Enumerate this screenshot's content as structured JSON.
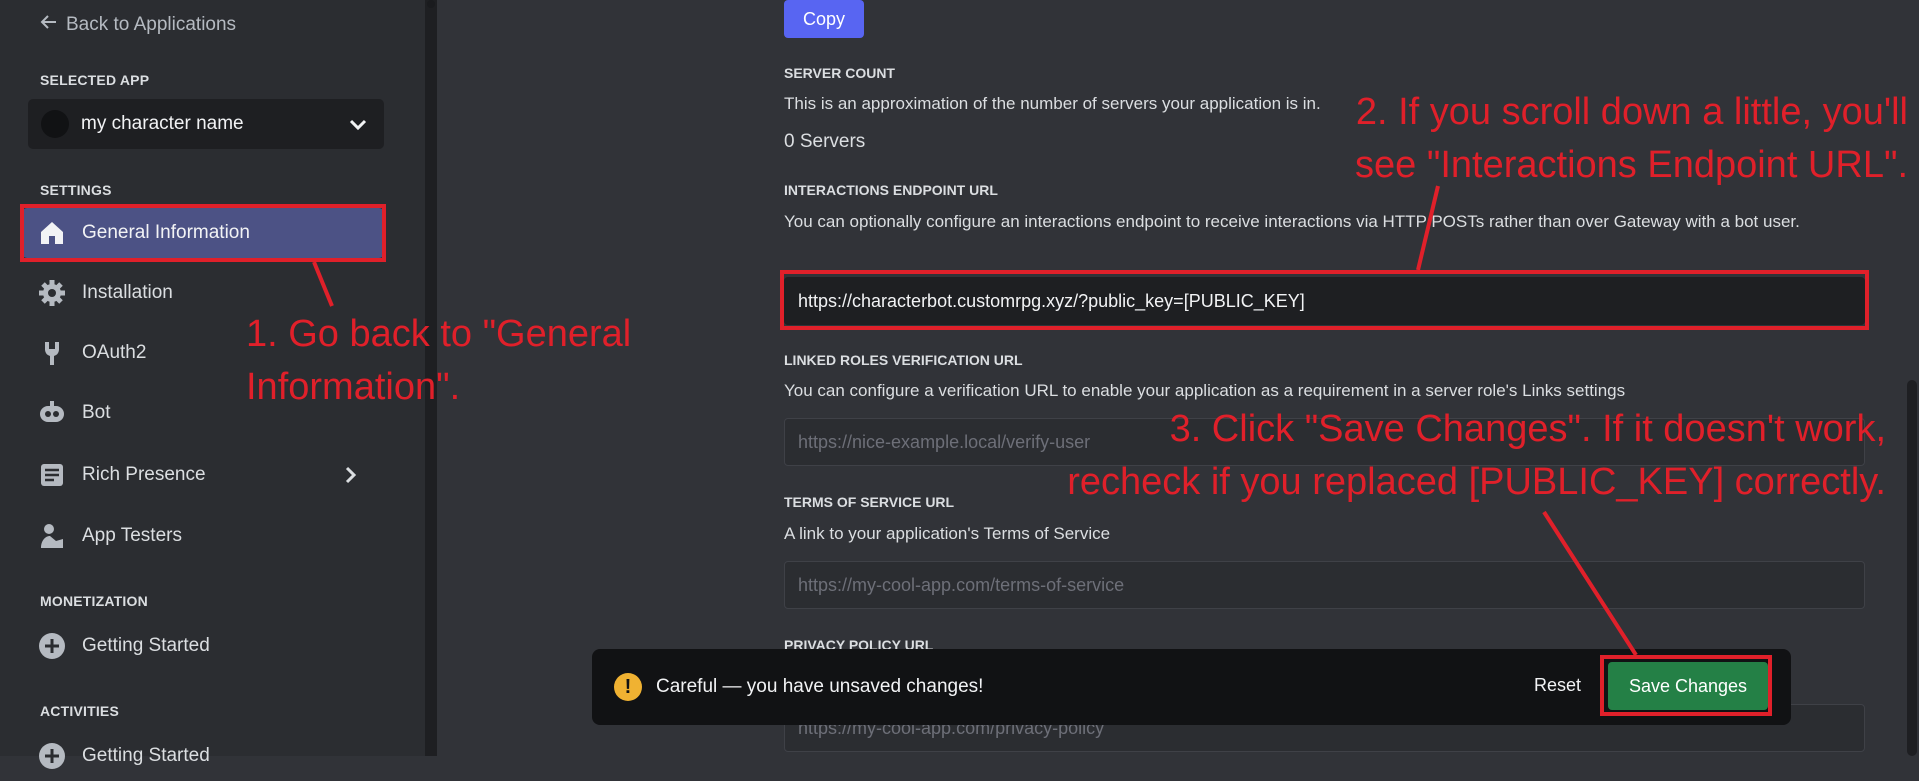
{
  "sidebar": {
    "back_label": "Back to Applications",
    "selected_app_title": "SELECTED APP",
    "app_name": "my character name",
    "settings_title": "SETTINGS",
    "items": [
      {
        "label": "General Information",
        "icon": "home-icon"
      },
      {
        "label": "Installation",
        "icon": "gear-icon"
      },
      {
        "label": "OAuth2",
        "icon": "wrench-icon"
      },
      {
        "label": "Bot",
        "icon": "bot-icon"
      },
      {
        "label": "Rich Presence",
        "icon": "document-icon"
      },
      {
        "label": "App Testers",
        "icon": "user-icon"
      }
    ],
    "monetization_title": "MONETIZATION",
    "monetization_items": [
      {
        "label": "Getting Started",
        "icon": "plus-circle-icon"
      }
    ],
    "activities_title": "ACTIVITIES",
    "activities_items": [
      {
        "label": "Getting Started",
        "icon": "plus-circle-icon"
      }
    ]
  },
  "main": {
    "copy_label": "Copy",
    "server_count": {
      "title": "SERVER COUNT",
      "desc": "This is an approximation of the number of servers your application is in.",
      "value": "0 Servers"
    },
    "interactions": {
      "title": "INTERACTIONS ENDPOINT URL",
      "desc": "You can optionally configure an interactions endpoint to receive interactions via HTTP POSTs rather than over Gateway with a bot user.",
      "value": "https://characterbot.customrpg.xyz/?public_key=[PUBLIC_KEY]"
    },
    "linked_roles": {
      "title": "LINKED ROLES VERIFICATION URL",
      "desc": "You can configure a verification URL to enable your application as a requirement in a server role's Links settings",
      "placeholder": "https://nice-example.local/verify-user"
    },
    "tos": {
      "title": "TERMS OF SERVICE URL",
      "desc": "A link to your application's Terms of Service",
      "placeholder": "https://my-cool-app.com/terms-of-service"
    },
    "privacy": {
      "title": "PRIVACY POLICY URL",
      "placeholder": "https://my-cool-app.com/privacy-policy"
    }
  },
  "unsaved": {
    "message": "Careful — you have unsaved changes!",
    "reset_label": "Reset",
    "save_label": "Save Changes"
  },
  "annotations": {
    "step1_line1": "1. Go back to \"General",
    "step1_line2": "Information\".",
    "step2_line1": "2. If you scroll down a little, you'll",
    "step2_line2": "see \"Interactions Endpoint URL\".",
    "step3_line1": "3. Click \"Save Changes\". If it doesn't work,",
    "step3_line2": "recheck if you replaced [PUBLIC_KEY] correctly."
  },
  "colors": {
    "accent": "#5865f2",
    "save": "#248046",
    "annotation": "#e0202a",
    "warning": "#f0b232"
  }
}
